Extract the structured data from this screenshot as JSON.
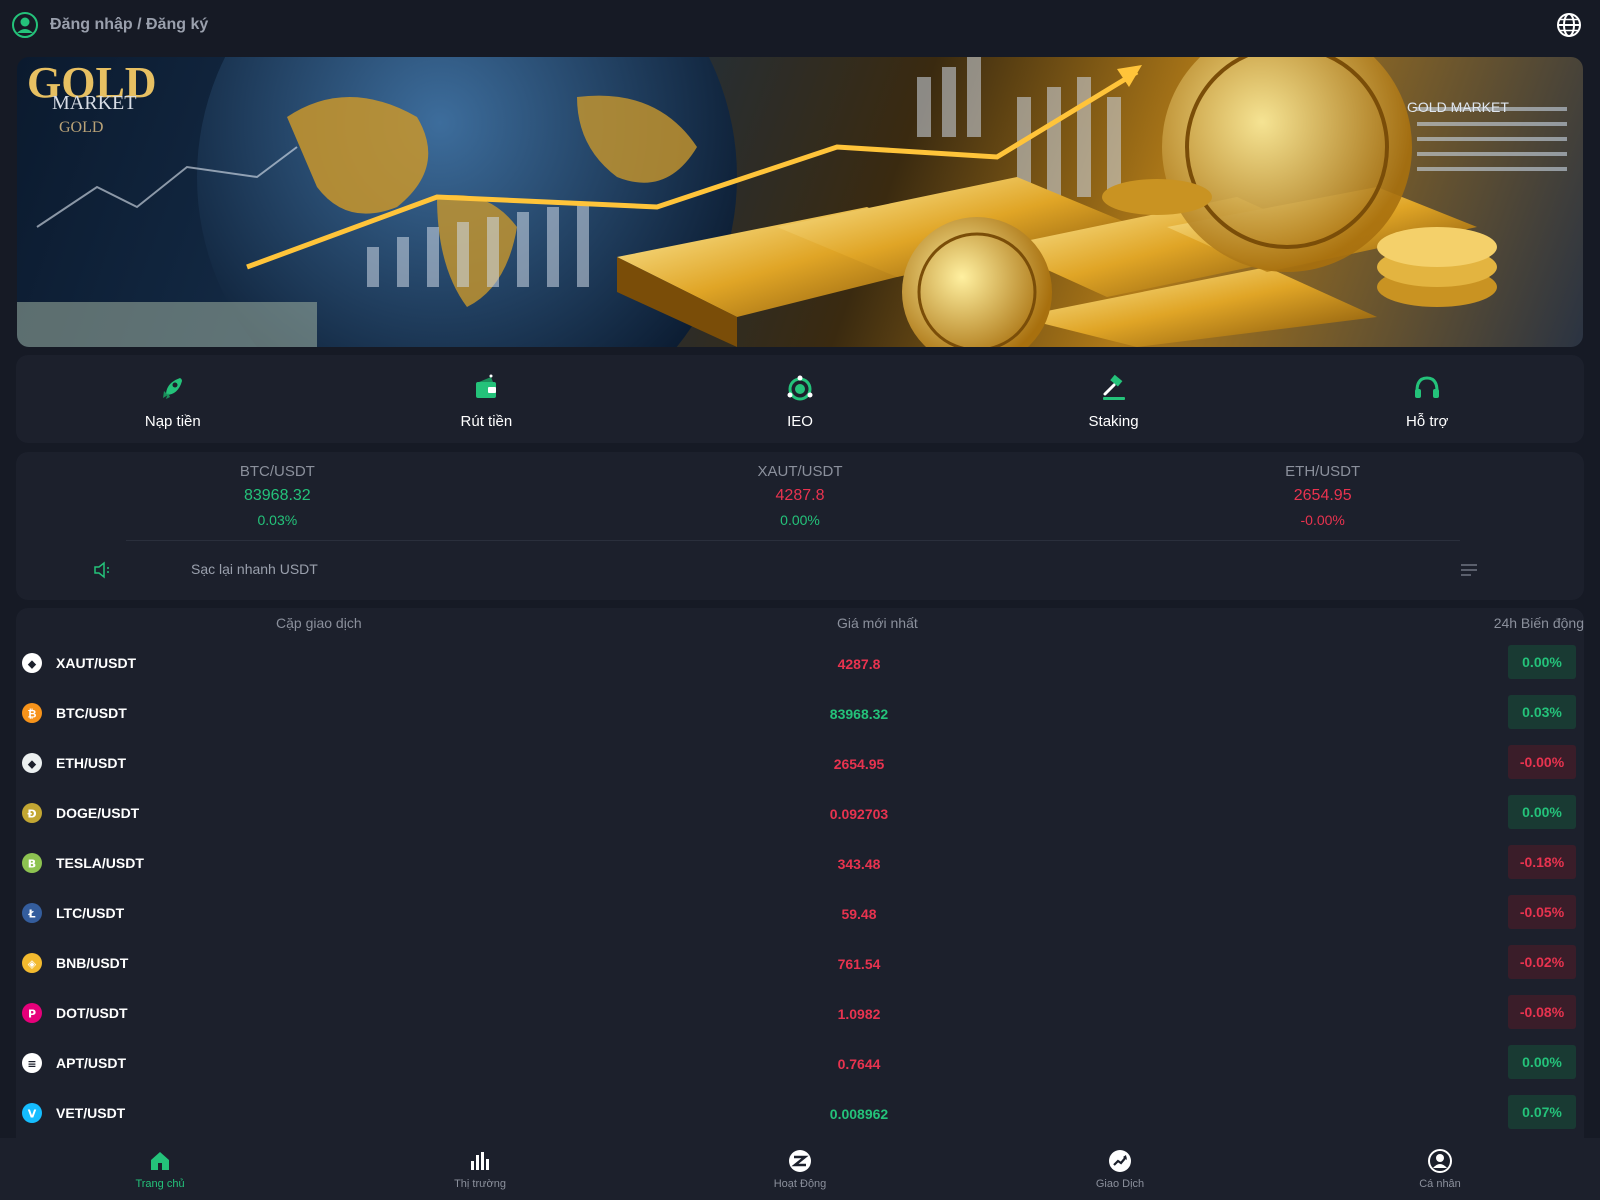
{
  "header": {
    "login_label": "Đăng nhập / Đăng ký"
  },
  "banner": {
    "title_line1": "GOLD",
    "title_line2": "MARKET",
    "title_line3": "GOLD",
    "corner_text": "GOLD MARKET"
  },
  "actions": [
    {
      "label": "Nạp tiền",
      "icon": "rocket-icon"
    },
    {
      "label": "Rút tiền",
      "icon": "wallet-icon"
    },
    {
      "label": "IEO",
      "icon": "ieo-icon"
    },
    {
      "label": "Staking",
      "icon": "hammer-icon"
    },
    {
      "label": "Hỗ trợ",
      "icon": "headset-icon"
    }
  ],
  "tickers": [
    {
      "pair": "BTC/USDT",
      "price": "83968.32",
      "change": "0.03%",
      "price_color": "green",
      "change_color": "green"
    },
    {
      "pair": "XAUT/USDT",
      "price": "4287.8",
      "change": "0.00%",
      "price_color": "red",
      "change_color": "green"
    },
    {
      "pair": "ETH/USDT",
      "price": "2654.95",
      "change": "-0.00%",
      "price_color": "red",
      "change_color": "red"
    }
  ],
  "notice": {
    "text": "Sạc lại nhanh USDT"
  },
  "market": {
    "col_pair": "Cặp giao dịch",
    "col_price": "Giá mới nhất",
    "col_change": "24h Biến động",
    "rows": [
      {
        "symbol": "XAUT/USDT",
        "price": "4287.8",
        "change": "0.00%",
        "price_dir": "red",
        "change_dir": "up",
        "coin_color": "#ffffff",
        "coin_glyph": "◆"
      },
      {
        "symbol": "BTC/USDT",
        "price": "83968.32",
        "change": "0.03%",
        "price_dir": "green",
        "change_dir": "up",
        "coin_color": "#f7931a",
        "coin_glyph": "₿"
      },
      {
        "symbol": "ETH/USDT",
        "price": "2654.95",
        "change": "-0.00%",
        "price_dir": "red",
        "change_dir": "down",
        "coin_color": "#ecf0f1",
        "coin_glyph": "◆"
      },
      {
        "symbol": "DOGE/USDT",
        "price": "0.092703",
        "change": "0.00%",
        "price_dir": "red",
        "change_dir": "up",
        "coin_color": "#c2a633",
        "coin_glyph": "Ð"
      },
      {
        "symbol": "TESLA/USDT",
        "price": "343.48",
        "change": "-0.18%",
        "price_dir": "red",
        "change_dir": "down",
        "coin_color": "#8dc351",
        "coin_glyph": "B"
      },
      {
        "symbol": "LTC/USDT",
        "price": "59.48",
        "change": "-0.05%",
        "price_dir": "red",
        "change_dir": "down",
        "coin_color": "#345d9d",
        "coin_glyph": "Ł"
      },
      {
        "symbol": "BNB/USDT",
        "price": "761.54",
        "change": "-0.02%",
        "price_dir": "red",
        "change_dir": "down",
        "coin_color": "#f3ba2f",
        "coin_glyph": "◈"
      },
      {
        "symbol": "DOT/USDT",
        "price": "1.0982",
        "change": "-0.08%",
        "price_dir": "red",
        "change_dir": "down",
        "coin_color": "#e6007a",
        "coin_glyph": "P"
      },
      {
        "symbol": "APT/USDT",
        "price": "0.7644",
        "change": "0.00%",
        "price_dir": "red",
        "change_dir": "up",
        "coin_color": "#ffffff",
        "coin_glyph": "≡"
      },
      {
        "symbol": "VET/USDT",
        "price": "0.008962",
        "change": "0.07%",
        "price_dir": "green",
        "change_dir": "up",
        "coin_color": "#15bdff",
        "coin_glyph": "V"
      }
    ]
  },
  "bottom_nav": [
    {
      "label": "Trang chủ",
      "icon": "home-icon",
      "active": true
    },
    {
      "label": "Thị trường",
      "icon": "bar-chart-icon",
      "active": false
    },
    {
      "label": "Hoạt Động",
      "icon": "activity-icon",
      "active": false
    },
    {
      "label": "Giao Dịch",
      "icon": "trade-icon",
      "active": false
    },
    {
      "label": "Cá nhân",
      "icon": "profile-icon",
      "active": false
    }
  ],
  "colors": {
    "accent": "#24c27a",
    "down": "#e8334f",
    "card": "#1c202c",
    "bg": "#161a25"
  }
}
